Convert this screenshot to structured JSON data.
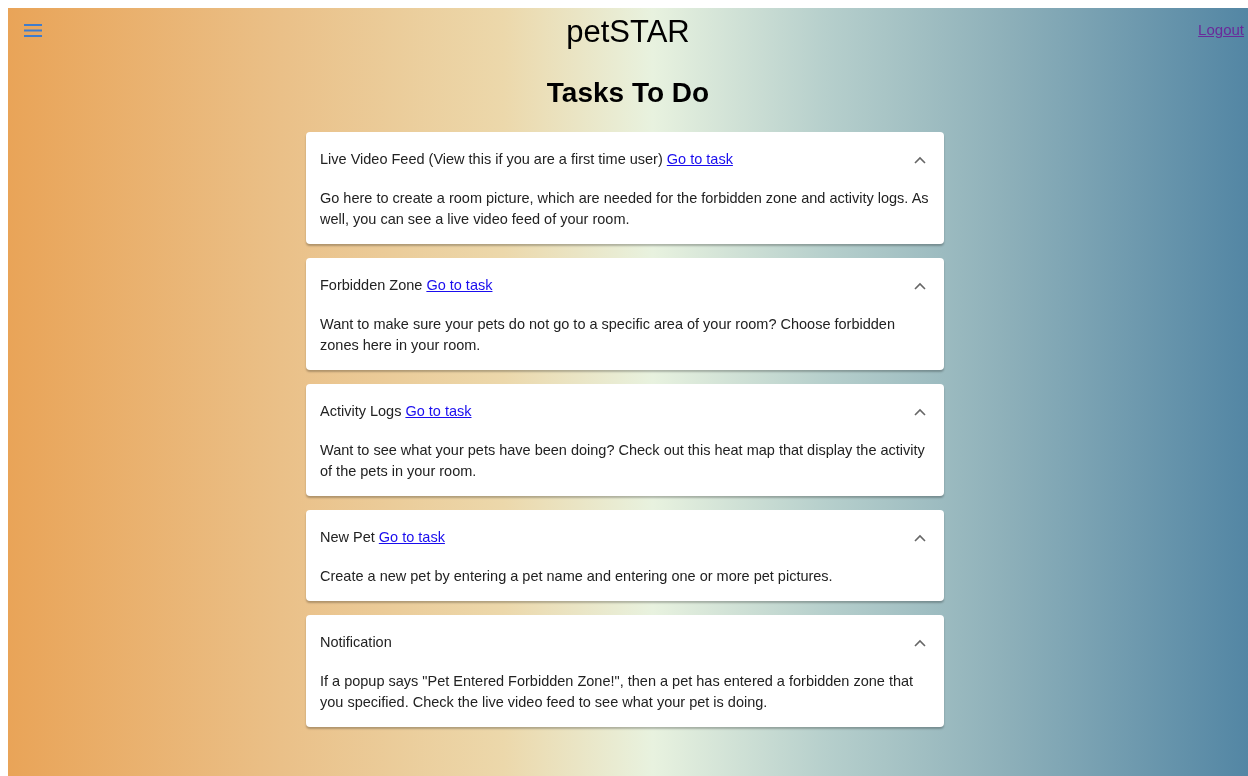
{
  "header": {
    "title": "petSTAR",
    "logout": "Logout"
  },
  "heading": "Tasks To Do",
  "tasks": [
    {
      "title": "Live Video Feed (View this if you are a first time user)",
      "link": "Go to task",
      "expanded": true,
      "description": "Go here to create a room picture, which are needed for the forbidden zone and activity logs. As well, you can see a live video feed of your room."
    },
    {
      "title": "Forbidden Zone",
      "link": "Go to task",
      "expanded": true,
      "description": "Want to make sure your pets do not go to a specific area of your room? Choose forbidden zones here in your room."
    },
    {
      "title": "Activity Logs",
      "link": "Go to task",
      "expanded": true,
      "description": "Want to see what your pets have been doing? Check out this heat map that display the activity of the pets in your room."
    },
    {
      "title": "New Pet",
      "link": "Go to task",
      "expanded": true,
      "description": "Create a new pet by entering a pet name and entering one or more pet pictures."
    },
    {
      "title": "Notification",
      "expanded": true,
      "description": "If a popup says \"Pet Entered Forbidden Zone!\", then a pet has entered a forbidden zone that you specified. Check the live video feed to see what your pet is doing."
    }
  ]
}
